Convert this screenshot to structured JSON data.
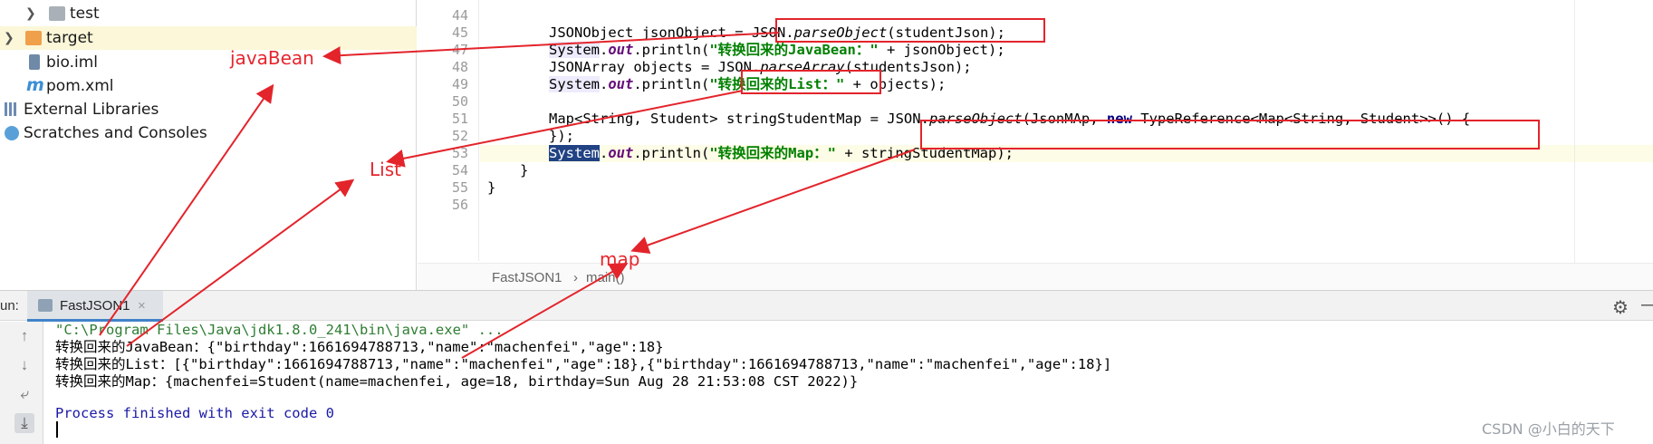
{
  "tree": {
    "items": [
      {
        "label": "test",
        "icon": "folder-icon"
      },
      {
        "label": "target",
        "icon": "folder-icon"
      },
      {
        "label": "bio.iml",
        "icon": "iml-file-icon"
      },
      {
        "label": "pom.xml",
        "icon": "maven-icon",
        "icon_glyph": "m"
      },
      {
        "label": "External Libraries",
        "icon": "library-icon"
      },
      {
        "label": "Scratches and Consoles",
        "icon": "scratches-icon"
      }
    ]
  },
  "editor": {
    "line_numbers": [
      "44",
      "45",
      "47",
      "48",
      "49",
      "50",
      "51",
      "52",
      "53",
      "54",
      "55",
      "56"
    ],
    "code": {
      "l45_a": "JSONObject jsonObject = ",
      "l45_b": "JSON.",
      "l45_c": "parseObject",
      "l45_d": "(studentJson);",
      "l47_a": "System",
      "l47_b": ".",
      "l47_c": "out",
      "l47_d": ".println(",
      "l47_e": "\"转换回来的JavaBean：\"",
      "l47_f": " + jsonObject);",
      "l48_a": "JSONArray objects = ",
      "l48_b": "JSON.",
      "l48_c": "parseArray",
      "l48_d": "(studentsJson);",
      "l49_a": "System",
      "l49_b": ".",
      "l49_c": "out",
      "l49_d": ".println(",
      "l49_e": "\"转换回来的List：\"",
      "l49_f": " + objects);",
      "l51_a": "Map<String, Student> stringStudentMap = JSON.",
      "l51_b": "parseObject",
      "l51_c": "(JsonMAp, ",
      "l51_d": "new",
      "l51_e": " TypeReference<Map<String, Student>>() {",
      "l52": "});",
      "l53_a": "System",
      "l53_b": ".",
      "l53_c": "out",
      "l53_d": ".println(",
      "l53_e": "\"转换回来的Map：\"",
      "l53_f": " + stringStudentMap);",
      "l54": "}",
      "l55": "}"
    },
    "breadcrumb": {
      "class": "FastJSON1",
      "method": "main()",
      "separator": "›"
    }
  },
  "run": {
    "label": "un:",
    "tab_label": "FastJSON1",
    "tab_close": "×",
    "gear": "⚙",
    "minimize": "—",
    "toolbar": [
      "↑",
      "↓",
      "⤶",
      "⤓"
    ],
    "console": {
      "command": "\"C:\\Program Files\\Java\\jdk1.8.0_241\\bin\\java.exe\" ...",
      "out1": "转换回来的JavaBean：{\"birthday\":1661694788713,\"name\":\"machenfei\",\"age\":18}",
      "out2": "转换回来的List：[{\"birthday\":1661694788713,\"name\":\"machenfei\",\"age\":18},{\"birthday\":1661694788713,\"name\":\"machenfei\",\"age\":18}]",
      "out3": "转换回来的Map：{machenfei=Student(name=machenfei, age=18, birthday=Sun Aug 28 21:53:08 CST 2022)}",
      "exit": "Process finished with exit code 0"
    }
  },
  "annotations": {
    "javabean": "javaBean",
    "list": "List",
    "map": "map",
    "color": "#e3242b"
  },
  "watermark": "CSDN @小白的天下"
}
